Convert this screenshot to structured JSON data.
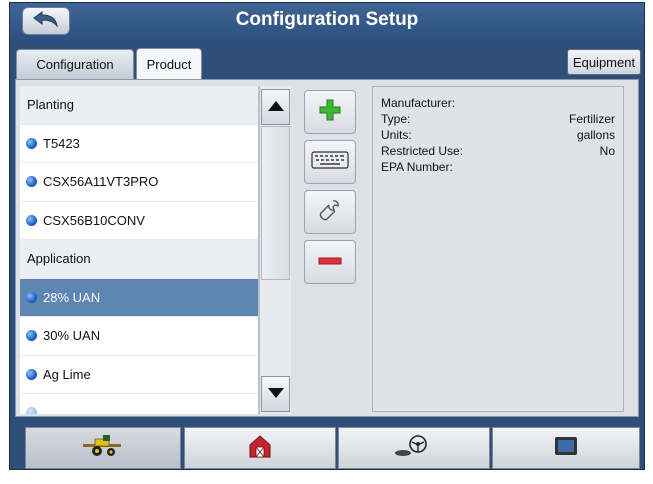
{
  "window": {
    "title": "Configuration Setup"
  },
  "tabs": [
    {
      "label": "Configuration",
      "active": false
    },
    {
      "label": "Product",
      "active": true
    }
  ],
  "equipment_button": {
    "label": "Equipment"
  },
  "product_list": {
    "rows": [
      {
        "kind": "header",
        "label": "Planting"
      },
      {
        "kind": "item",
        "label": "T5423",
        "selected": false
      },
      {
        "kind": "item",
        "label": "CSX56A11VT3PRO",
        "selected": false
      },
      {
        "kind": "item",
        "label": "CSX56B10CONV",
        "selected": false
      },
      {
        "kind": "header",
        "label": "Application"
      },
      {
        "kind": "item",
        "label": "28% UAN",
        "selected": true
      },
      {
        "kind": "item",
        "label": "30% UAN",
        "selected": false
      },
      {
        "kind": "item",
        "label": "Ag Lime",
        "selected": false
      }
    ]
  },
  "scrollbar": {
    "up_icon": "triangle-up",
    "down_icon": "triangle-down"
  },
  "tools": [
    {
      "name": "add-product-button",
      "icon": "plus-icon"
    },
    {
      "name": "rename-button",
      "icon": "keyboard-icon"
    },
    {
      "name": "edit-button",
      "icon": "wrench-icon"
    },
    {
      "name": "delete-button",
      "icon": "minus-icon"
    }
  ],
  "details": {
    "manufacturer_label": "Manufacturer:",
    "manufacturer_value": "",
    "type_label": "Type:",
    "type_value": "Fertilizer",
    "units_label": "Units:",
    "units_value": "gallons",
    "restricted_label": "Restricted Use:",
    "restricted_value": "No",
    "epa_label": "EPA Number:",
    "epa_value": ""
  },
  "bottom_nav": [
    {
      "icon": "tractor-icon",
      "active": true
    },
    {
      "icon": "farm-icon",
      "active": false
    },
    {
      "icon": "steering-icon",
      "active": false
    },
    {
      "icon": "display-icon",
      "active": false
    }
  ],
  "colors": {
    "frame": "#2f4f78",
    "selected_row": "#5e86b4",
    "plus_green": "#3fb83a",
    "minus_red": "#e0303a"
  }
}
